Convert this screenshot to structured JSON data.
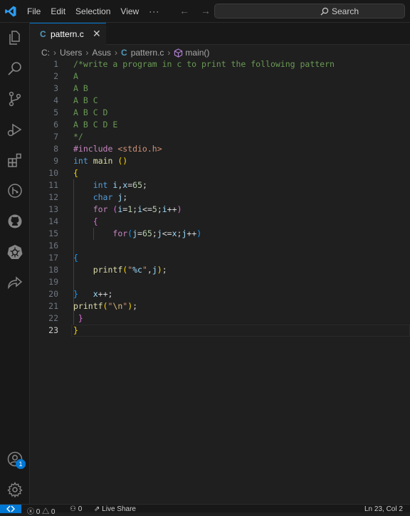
{
  "menu": {
    "items": [
      "File",
      "Edit",
      "Selection",
      "View"
    ],
    "more": "···"
  },
  "nav": {
    "back": "←",
    "forward": "→"
  },
  "search": {
    "label": "Search"
  },
  "tab": {
    "icon_text": "C",
    "name": "pattern.c",
    "close": "✕"
  },
  "breadcrumb": {
    "parts": [
      "C:",
      "Users",
      "Asus"
    ],
    "file_icon": "C",
    "file": "pattern.c",
    "symbol": "main()"
  },
  "editor": {
    "active_line": 23,
    "lines": [
      {
        "n": "1",
        "segs": [
          {
            "t": "/*write a program in c to print the following pattern",
            "c": "#6a9955"
          }
        ]
      },
      {
        "n": "2",
        "segs": [
          {
            "t": "A",
            "c": "#6a9955"
          }
        ]
      },
      {
        "n": "3",
        "segs": [
          {
            "t": "A B",
            "c": "#6a9955"
          }
        ]
      },
      {
        "n": "4",
        "segs": [
          {
            "t": "A B C",
            "c": "#6a9955"
          }
        ]
      },
      {
        "n": "5",
        "segs": [
          {
            "t": "A B C D",
            "c": "#6a9955"
          }
        ]
      },
      {
        "n": "6",
        "segs": [
          {
            "t": "A B C D E",
            "c": "#6a9955"
          }
        ]
      },
      {
        "n": "7",
        "segs": [
          {
            "t": "*/",
            "c": "#6a9955"
          }
        ]
      },
      {
        "n": "8",
        "segs": [
          {
            "t": "#include ",
            "c": "#c586c0"
          },
          {
            "t": "<stdio.h>",
            "c": "#ce9178"
          }
        ]
      },
      {
        "n": "9",
        "segs": [
          {
            "t": "int",
            "c": "#569cd6"
          },
          {
            "t": " ",
            "c": "#d4d4d4"
          },
          {
            "t": "main",
            "c": "#dcdcaa"
          },
          {
            "t": " ",
            "c": "#d4d4d4"
          },
          {
            "t": "()",
            "c": "#ffd700"
          }
        ]
      },
      {
        "n": "10",
        "segs": [
          {
            "t": "{",
            "c": "#ffd700"
          }
        ]
      },
      {
        "n": "11",
        "segs": [
          {
            "t": "    ",
            "c": "#d4d4d4"
          },
          {
            "t": "int",
            "c": "#569cd6"
          },
          {
            "t": " ",
            "c": "#d4d4d4"
          },
          {
            "t": "i",
            "c": "#9cdcfe"
          },
          {
            "t": ",",
            "c": "#d4d4d4"
          },
          {
            "t": "x",
            "c": "#9cdcfe"
          },
          {
            "t": "=",
            "c": "#d4d4d4"
          },
          {
            "t": "65",
            "c": "#b5cea8"
          },
          {
            "t": ";",
            "c": "#d4d4d4"
          }
        ]
      },
      {
        "n": "12",
        "segs": [
          {
            "t": "    ",
            "c": "#d4d4d4"
          },
          {
            "t": "char",
            "c": "#569cd6"
          },
          {
            "t": " ",
            "c": "#d4d4d4"
          },
          {
            "t": "j",
            "c": "#9cdcfe"
          },
          {
            "t": ";",
            "c": "#d4d4d4"
          }
        ]
      },
      {
        "n": "13",
        "segs": [
          {
            "t": "    ",
            "c": "#d4d4d4"
          },
          {
            "t": "for",
            "c": "#c586c0"
          },
          {
            "t": " ",
            "c": "#d4d4d4"
          },
          {
            "t": "(",
            "c": "#da70d6"
          },
          {
            "t": "i",
            "c": "#9cdcfe"
          },
          {
            "t": "=",
            "c": "#d4d4d4"
          },
          {
            "t": "1",
            "c": "#b5cea8"
          },
          {
            "t": ";",
            "c": "#d4d4d4"
          },
          {
            "t": "i",
            "c": "#9cdcfe"
          },
          {
            "t": "<=",
            "c": "#d4d4d4"
          },
          {
            "t": "5",
            "c": "#b5cea8"
          },
          {
            "t": ";",
            "c": "#d4d4d4"
          },
          {
            "t": "i",
            "c": "#9cdcfe"
          },
          {
            "t": "++",
            "c": "#d4d4d4"
          },
          {
            "t": ")",
            "c": "#da70d6"
          }
        ]
      },
      {
        "n": "14",
        "segs": [
          {
            "t": "    ",
            "c": "#d4d4d4"
          },
          {
            "t": "{",
            "c": "#da70d6"
          }
        ]
      },
      {
        "n": "15",
        "segs": [
          {
            "t": "        ",
            "c": "#d4d4d4"
          },
          {
            "t": "for",
            "c": "#c586c0"
          },
          {
            "t": "(",
            "c": "#179fff"
          },
          {
            "t": "j",
            "c": "#9cdcfe"
          },
          {
            "t": "=",
            "c": "#d4d4d4"
          },
          {
            "t": "65",
            "c": "#b5cea8"
          },
          {
            "t": ";",
            "c": "#d4d4d4"
          },
          {
            "t": "j",
            "c": "#9cdcfe"
          },
          {
            "t": "<=",
            "c": "#d4d4d4"
          },
          {
            "t": "x",
            "c": "#9cdcfe"
          },
          {
            "t": ";",
            "c": "#d4d4d4"
          },
          {
            "t": "j",
            "c": "#9cdcfe"
          },
          {
            "t": "++",
            "c": "#d4d4d4"
          },
          {
            "t": ")",
            "c": "#179fff"
          }
        ]
      },
      {
        "n": "16",
        "segs": []
      },
      {
        "n": "17",
        "segs": [
          {
            "t": "{",
            "c": "#179fff"
          }
        ]
      },
      {
        "n": "18",
        "segs": [
          {
            "t": "    ",
            "c": "#d4d4d4"
          },
          {
            "t": "printf",
            "c": "#dcdcaa"
          },
          {
            "t": "(",
            "c": "#ffd700"
          },
          {
            "t": "\"",
            "c": "#ce9178"
          },
          {
            "t": "%c",
            "c": "#9cdcfe"
          },
          {
            "t": "\"",
            "c": "#ce9178"
          },
          {
            "t": ",",
            "c": "#d4d4d4"
          },
          {
            "t": "j",
            "c": "#9cdcfe"
          },
          {
            "t": ")",
            "c": "#ffd700"
          },
          {
            "t": ";",
            "c": "#d4d4d4"
          }
        ]
      },
      {
        "n": "19",
        "segs": []
      },
      {
        "n": "20",
        "segs": [
          {
            "t": "}",
            "c": "#179fff"
          },
          {
            "t": "   ",
            "c": "#d4d4d4"
          },
          {
            "t": "x",
            "c": "#9cdcfe"
          },
          {
            "t": "++;",
            "c": "#d4d4d4"
          }
        ]
      },
      {
        "n": "21",
        "segs": [
          {
            "t": "printf",
            "c": "#dcdcaa"
          },
          {
            "t": "(",
            "c": "#ffd700"
          },
          {
            "t": "\"",
            "c": "#ce9178"
          },
          {
            "t": "\\n",
            "c": "#d7ba7d"
          },
          {
            "t": "\"",
            "c": "#ce9178"
          },
          {
            "t": ")",
            "c": "#ffd700"
          },
          {
            "t": ";",
            "c": "#d4d4d4"
          }
        ]
      },
      {
        "n": "22",
        "segs": [
          {
            "t": " }",
            "c": "#da70d6"
          }
        ]
      },
      {
        "n": "23",
        "segs": [
          {
            "t": "}",
            "c": "#ffd700"
          }
        ]
      }
    ]
  },
  "status": {
    "errors": "0",
    "warnings": "0",
    "ports": "0",
    "live_share": "Live Share",
    "cursor": "Ln 23, Col 2"
  },
  "accounts_badge": "1"
}
